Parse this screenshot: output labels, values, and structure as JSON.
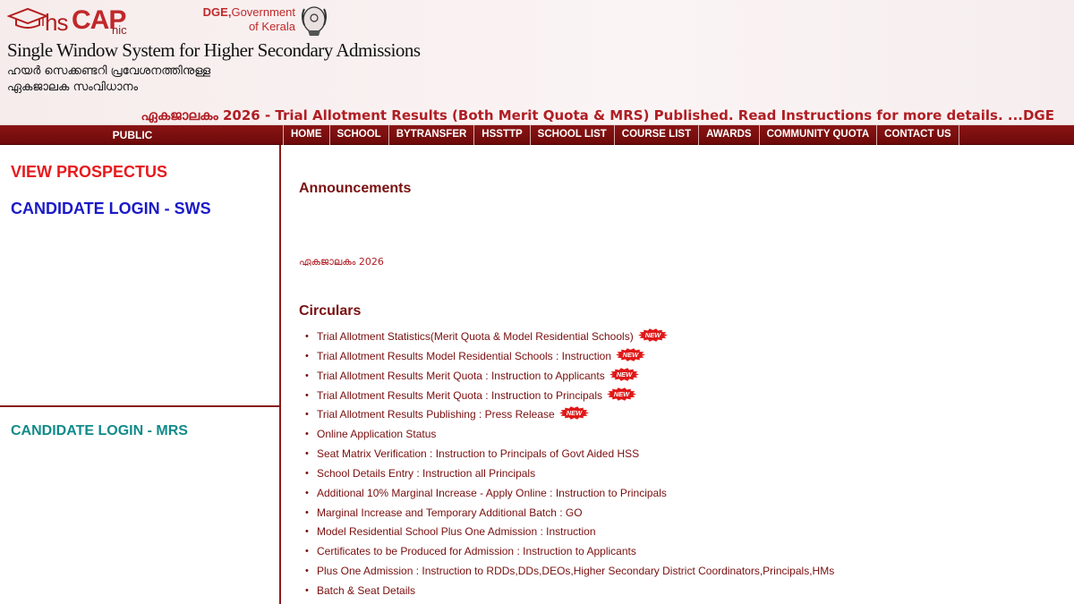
{
  "header": {
    "logo_text_hs": "hs",
    "logo_text_cap": "CAP",
    "logo_text_nic": "nic",
    "dge_bold": "DGE,",
    "dge_rest": "Government of Kerala",
    "site_title": "Single Window System for Higher Secondary Admissions",
    "malayalam_line1": "ഹയർ സെക്കണ്ടറി പ്രവേശനത്തിനുള്ള",
    "malayalam_line2": "ഏകജാലക സംവിധാനം"
  },
  "marquee_text": "ഏകജാലകം 2026 - Trial Allotment Results (Both Merit Quota & MRS) Published. Read Instructions for more details. ...DGE",
  "nav": {
    "public_label": "PUBLIC",
    "items": [
      "HOME",
      "SCHOOL",
      "BYTRANSFER",
      "HSSTTP",
      "SCHOOL LIST",
      "COURSE LIST",
      "AWARDS",
      "COMMUNITY QUOTA",
      "CONTACT US"
    ]
  },
  "left": {
    "view_prospectus": "VIEW PROSPECTUS",
    "candidate_login_sws": "CANDIDATE LOGIN - SWS",
    "candidate_login_mrs": "CANDIDATE LOGIN - MRS"
  },
  "main": {
    "announcements_heading": "Announcements",
    "announcement_ticker": "ഏകജാലകം 2026",
    "circulars_heading": "Circulars",
    "new_badge_text": "NEW",
    "circulars": [
      {
        "text": "Trial Allotment Statistics(Merit Quota & Model Residential Schools)",
        "is_new": true
      },
      {
        "text": "Trial Allotment Results Model Residential Schools : Instruction",
        "is_new": true
      },
      {
        "text": "Trial Allotment Results Merit Quota : Instruction to Applicants",
        "is_new": true
      },
      {
        "text": "Trial Allotment Results Merit Quota : Instruction to Principals",
        "is_new": true
      },
      {
        "text": "Trial Allotment Results Publishing : Press Release",
        "is_new": true
      },
      {
        "text": "Online Application Status",
        "is_new": false
      },
      {
        "text": "Seat Matrix Verification : Instruction to Principals of Govt Aided HSS",
        "is_new": false
      },
      {
        "text": "School Details Entry : Instruction all Principals",
        "is_new": false
      },
      {
        "text": "Additional 10% Marginal Increase - Apply Online : Instruction to Principals",
        "is_new": false
      },
      {
        "text": "Marginal Increase and Temporary Additional Batch : GO",
        "is_new": false
      },
      {
        "text": "Model Residential School Plus One Admission : Instruction",
        "is_new": false
      },
      {
        "text": "Certificates to be Produced for Admission : Instruction to Applicants",
        "is_new": false
      },
      {
        "text": "Plus One Admission : Instruction to RDDs,DDs,DEOs,Higher Secondary District Coordinators,Principals,HMs",
        "is_new": false
      },
      {
        "text": "Batch & Seat Details",
        "is_new": false
      }
    ]
  },
  "colors": {
    "brand_red": "#c0282a",
    "nav_maroon": "#7a0e0e",
    "prospectus_red": "#e8191c",
    "sws_blue": "#1a1ac8",
    "mrs_teal": "#128a8a"
  }
}
